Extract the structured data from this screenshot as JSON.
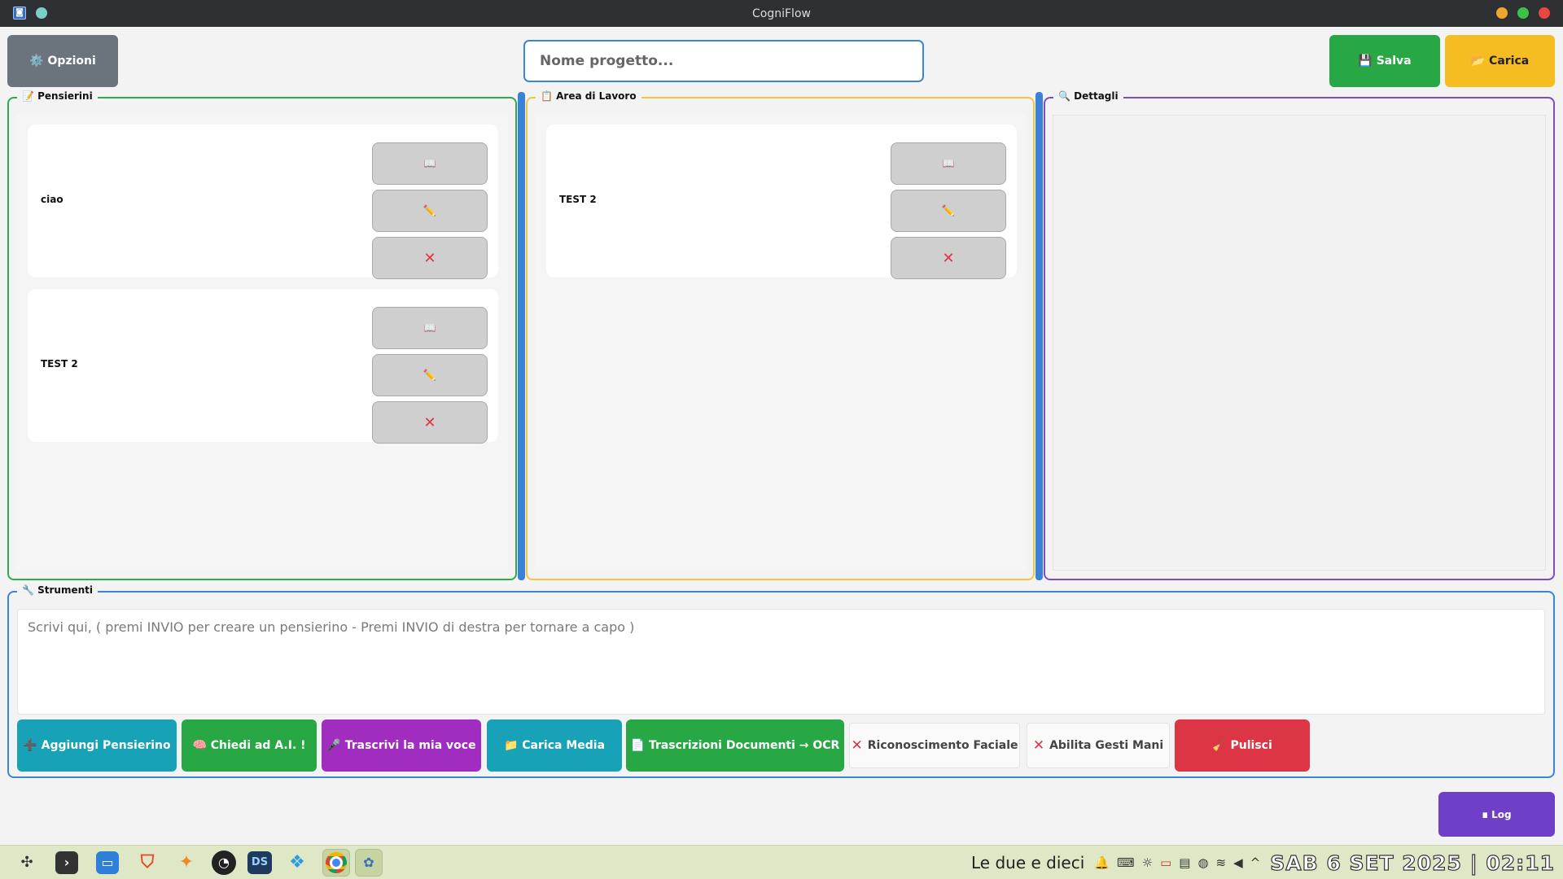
{
  "window": {
    "title": "CogniFlow"
  },
  "header": {
    "options_label": "⚙️ Opzioni",
    "project_placeholder": "Nome progetto...",
    "save_label": "💾 Salva",
    "load_label": "📂 Carica"
  },
  "panels": {
    "pensierini_title": "📝 Pensierini",
    "area_title": "📋 Area di Lavoro",
    "details_title": "🔍 Dettagli"
  },
  "pensierini": [
    {
      "label": "ciao"
    },
    {
      "label": "TEST 2"
    }
  ],
  "work_area": [
    {
      "label": "TEST 2"
    }
  ],
  "card_icons": {
    "read": "📖",
    "edit": "✏️",
    "delete": "✕"
  },
  "tools": {
    "title": "🔧 Strumenti",
    "input_placeholder": "Scrivi qui, ( premi INVIO per creare un pensierino - Premi INVIO di destra per tornare a capo )",
    "add_label": "➕ Aggiungi Pensierino",
    "ask_ai_label": "🧠 Chiedi ad A.I. !",
    "transcribe_label": "🎤 Trascrivi la mia voce",
    "media_label": "📁 Carica Media",
    "ocr_label": "📄 Trascrizioni Documenti → OCR",
    "face_label": "Riconoscimento Faciale",
    "gestures_label": "Abilita Gesti Mani",
    "clear_label": "🧹 Pulisci",
    "disabled_mark": "✕"
  },
  "log_label": "∎ Log",
  "taskbar": {
    "apps": [
      "launcher",
      "terminal",
      "files",
      "brave",
      "firefox",
      "obs",
      "ds",
      "cubes",
      "chrome",
      "cogniflow"
    ],
    "spoken_time": "Le due e dieci",
    "datetime": "SAB 6 SET 2025 | 02:11"
  },
  "colors": {
    "accent_blue": "#3a86d4",
    "green": "#28a745",
    "yellow": "#f6bd22",
    "purple": "#6f3fc7",
    "red": "#dc3545",
    "teal": "#17a2b8"
  }
}
